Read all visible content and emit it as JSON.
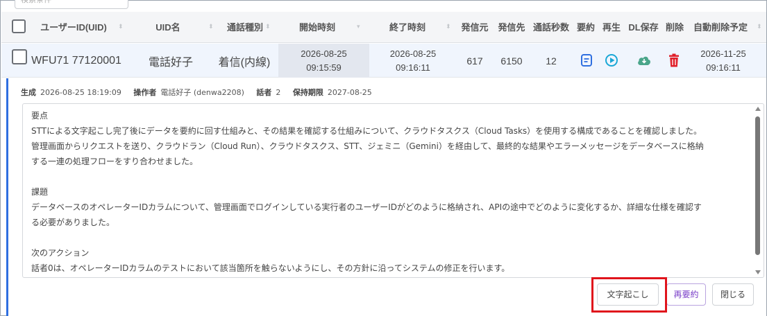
{
  "search": {
    "placeholder": "検索条件"
  },
  "table": {
    "headers": {
      "uid": "ユーザーID(UID)",
      "uid_name": "UID名",
      "call_type": "通話種別",
      "start_time": "開始時刻",
      "end_time": "終了時刻",
      "caller": "発信元",
      "callee": "発信先",
      "duration": "通話秒数",
      "summary": "要約",
      "play": "再生",
      "dl_save": "DL保存",
      "delete": "削除",
      "auto_delete": "自動削除予定"
    },
    "row": {
      "uid": "WFU71 77120001",
      "uid_name": "電話好子",
      "call_type": "着信(内線)",
      "start_date": "2026-08-25",
      "start_time": "09:15:59",
      "end_date": "2026-08-25",
      "end_time": "09:16:11",
      "caller": "617",
      "callee": "6150",
      "duration": "12",
      "auto_delete_date": "2026-11-25",
      "auto_delete_time": "09:16:11"
    }
  },
  "detail": {
    "meta": {
      "created_label": "生成",
      "created_value": "2026-08-25 18:19:09",
      "operator_label": "操作者",
      "operator_value": "電話好子 (denwa2208)",
      "speakers_label": "話者",
      "speakers_value": "2",
      "retention_label": "保持期限",
      "retention_value": "2027-08-25"
    },
    "summary": {
      "heading1": "要点",
      "line1": "STTによる文字起こし完了後にデータを要約に回す仕組みと、その結果を確認する仕組みについて、クラウドタスクス（Cloud Tasks）を使用する構成であることを確認しました。",
      "line2": "管理画面からリクエストを送り、クラウドラン（Cloud Run）、クラウドタスクス、STT、ジェミニ（Gemini）を経由して、最終的な結果やエラーメッセージをデータベースに格納",
      "line3": "する一連の処理フローをすり合わせました。",
      "heading2": "課題",
      "line4": "データベースのオペレーターIDカラムについて、管理画面でログインしている実行者のユーザーIDがどのように格納され、APIの途中でどのように変化するか、詳細な仕様を確認す",
      "line5": "る必要がありました。",
      "heading3": "次のアクション",
      "line6": "話者0は、オペレーターIDカラムのテストにおいて該当箇所を触らないようにし、その方針に沿ってシステムの修正を行います。"
    },
    "buttons": {
      "transcribe": "文字起こし",
      "resummarize": "再要約",
      "close": "閉じる"
    }
  },
  "colors": {
    "accent_blue": "#2f6fe0",
    "play_cyan": "#1aa7d6",
    "download_green": "#4aa58a",
    "delete_red": "#e0202a",
    "resummarize_purple": "#7a3fc8",
    "highlight_red": "#e0141c"
  },
  "icons": {
    "summary": "document-icon",
    "play": "play-circle-icon",
    "dl_save": "cloud-download-icon",
    "delete": "trash-icon"
  }
}
